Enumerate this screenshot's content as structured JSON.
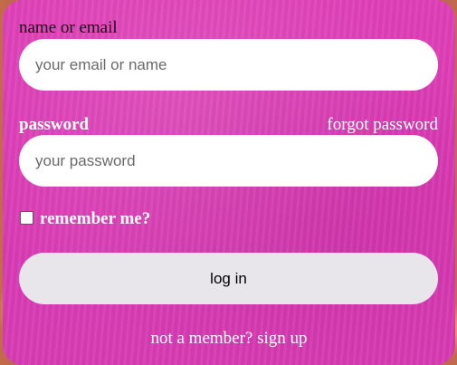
{
  "login": {
    "name_label": "name or email",
    "name_placeholder": "your email or name",
    "password_label": "password",
    "forgot_password": "forgot password",
    "password_placeholder": "your password",
    "remember_label": "remember me?",
    "remember_checked": false,
    "login_button": "log in",
    "signup_link": "not a member? sign up"
  },
  "colors": {
    "card": "#dc3cb6",
    "input_bg": "#ffffff",
    "button_bg": "#e8e6eb"
  }
}
